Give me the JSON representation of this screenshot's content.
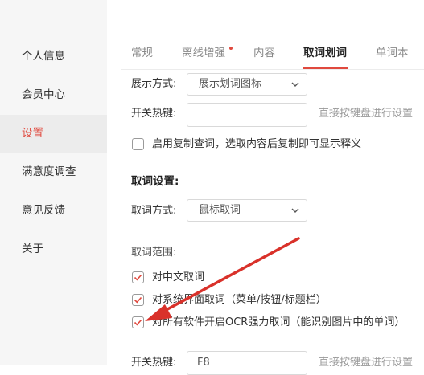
{
  "sidebar": {
    "items": [
      {
        "label": "个人信息"
      },
      {
        "label": "会员中心"
      },
      {
        "label": "设置"
      },
      {
        "label": "满意度调查"
      },
      {
        "label": "意见反馈"
      },
      {
        "label": "关于"
      }
    ],
    "active_index": 2
  },
  "tabs": [
    {
      "label": "常规"
    },
    {
      "label": "离线增强"
    },
    {
      "label": "内容"
    },
    {
      "label": "取词划词"
    },
    {
      "label": "单词本"
    }
  ],
  "display": {
    "label": "展示方式:",
    "value": "展示划词图标"
  },
  "hotkey1": {
    "label": "开关热键:",
    "value": "",
    "hint": "直接按键盘进行设置"
  },
  "copy_lookup": {
    "label": "启用复制查词，选取内容后复制即可显示释义",
    "checked": false
  },
  "lookup_settings": {
    "title": "取词设置:",
    "method_label": "取词方式:",
    "method_value": "鼠标取词",
    "range_label": "取词范围:",
    "options": [
      {
        "label": "对中文取词",
        "checked": true
      },
      {
        "label": "对系统界面取词（菜单/按钮/标题栏）",
        "checked": true
      },
      {
        "label": "对所有软件开启OCR强力取词（能识别图片中的单词）",
        "checked": true
      }
    ]
  },
  "hotkey2": {
    "label": "开关热键:",
    "value": "F8",
    "hint": "直接按键盘进行设置"
  },
  "colors": {
    "accent": "#e0493e",
    "arrow": "#d9312a",
    "sidebar_bg": "#f6f6f6",
    "sidebar_active_bg": "#ececec"
  }
}
